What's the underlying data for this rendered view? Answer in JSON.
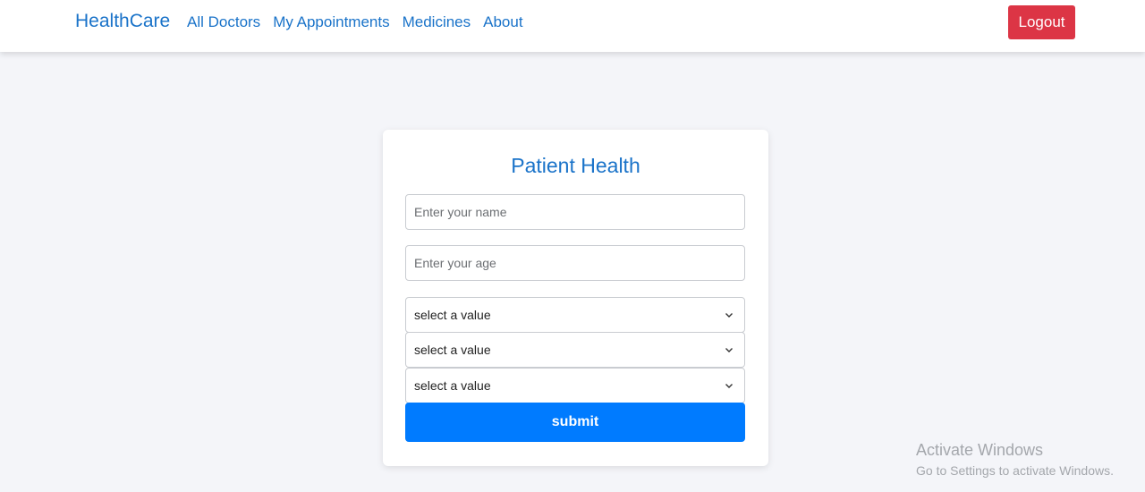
{
  "navbar": {
    "brand": "HealthCare",
    "links": [
      "All Doctors",
      "My Appointments",
      "Medicines",
      "About"
    ],
    "logout_label": "Logout"
  },
  "form": {
    "title": "Patient Health",
    "name_placeholder": "Enter your name",
    "age_placeholder": "Enter your age",
    "selects": [
      "select a value",
      "select a value",
      "select a value"
    ],
    "submit_label": "submit"
  },
  "watermark": {
    "title": "Activate Windows",
    "subtitle": "Go to Settings to activate Windows."
  },
  "colors": {
    "accent": "#1a73c9",
    "primary_button": "#007bff",
    "danger_button": "#dc3545",
    "background": "#f4f5f9"
  }
}
